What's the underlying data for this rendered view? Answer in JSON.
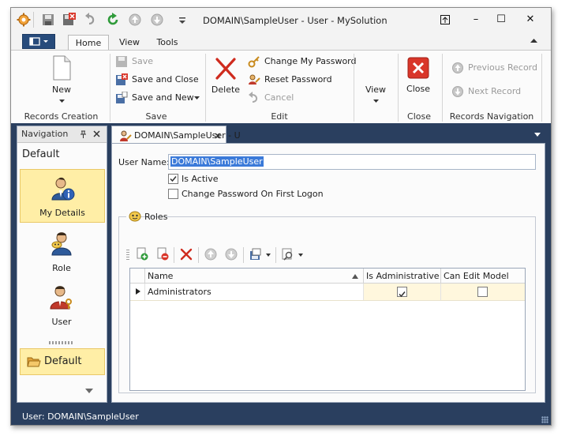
{
  "window": {
    "title": "DOMAIN\\SampleUser - User - MySolution",
    "caption_buttons": {
      "restore": "⊼",
      "minimize": "–",
      "maximize": "☐",
      "close": "✕"
    }
  },
  "ribbon_tabs": {
    "home": "Home",
    "view": "View",
    "tools": "Tools"
  },
  "ribbon": {
    "records_creation": {
      "new_label": "New",
      "group_label": "Records Creation"
    },
    "save": {
      "save": "Save",
      "save_and_close": "Save and Close",
      "save_and_new": "Save and New",
      "group_label": "Save"
    },
    "edit": {
      "delete": "Delete",
      "change_password": "Change My Password",
      "reset_password": "Reset Password",
      "cancel": "Cancel",
      "group_label": "Edit"
    },
    "view": {
      "view": "View"
    },
    "close": {
      "close": "Close",
      "group_label": "Close"
    },
    "records_navigation": {
      "previous": "Previous Record",
      "next": "Next Record",
      "group_label": "Records Navigation"
    }
  },
  "navigation": {
    "header": "Navigation",
    "group": "Default",
    "items": [
      {
        "label": "My Details",
        "selected": true
      },
      {
        "label": "Role",
        "selected": false
      },
      {
        "label": "User",
        "selected": false
      }
    ],
    "footer_group": "Default"
  },
  "document_tab": {
    "label": "DOMAIN\\SampleUser - U"
  },
  "form": {
    "user_name_label": "User Name:",
    "user_name_value": "DOMAIN\\SampleUser",
    "is_active_label": "Is Active",
    "is_active": true,
    "change_password_label": "Change Password On First Logon",
    "change_password": false
  },
  "roles": {
    "title": "Roles",
    "columns": [
      "Name",
      "Is Administrative",
      "Can Edit Model"
    ],
    "rows": [
      {
        "name": "Administrators",
        "is_administrative": true,
        "can_edit_model": false
      }
    ]
  },
  "status_bar": {
    "text": "User: DOMAIN\\SampleUser"
  },
  "colors": {
    "accent_dark": "#2a3f5f",
    "selection": "#ffeea6",
    "close_red": "#d9362a"
  }
}
